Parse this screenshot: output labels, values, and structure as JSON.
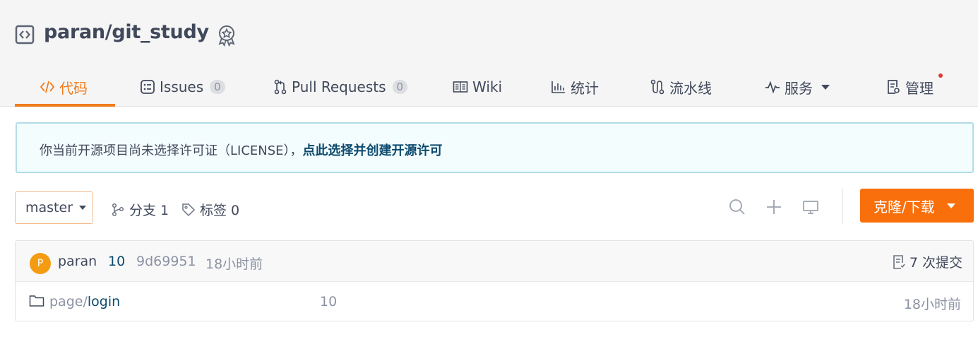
{
  "repo": {
    "title": "paran/git_study"
  },
  "colors": {
    "accent": "#f17c1c",
    "button": "#f96f0b",
    "link": "#0c4a6e",
    "notice_border": "#b3dde6",
    "avatar": "#f39c12"
  },
  "tabs": [
    {
      "label": "代码",
      "icon": "code-icon",
      "active": true
    },
    {
      "label": "Issues",
      "icon": "issues-icon",
      "count": "0"
    },
    {
      "label": "Pull Requests",
      "icon": "pull-request-icon",
      "count": "0"
    },
    {
      "label": "Wiki",
      "icon": "book-icon"
    },
    {
      "label": "统计",
      "icon": "chart-icon"
    },
    {
      "label": "流水线",
      "icon": "pipeline-icon"
    },
    {
      "label": "服务",
      "icon": "pulse-icon"
    },
    {
      "label": "管理",
      "icon": "settings-doc-icon"
    }
  ],
  "notice": {
    "text": "你当前开源项目尚未选择许可证（LICENSE），",
    "link": "点此选择并创建开源许可"
  },
  "toolbar": {
    "branch": "master",
    "branches": "分支 1",
    "tags": "标签 0",
    "clone_label": "克隆/下载"
  },
  "commit": {
    "avatar_letter": "P",
    "author": "paran",
    "message": "10",
    "hash": "9d69951",
    "time": "18小时前",
    "count": "7 次提交"
  },
  "files": [
    {
      "prefix": "page/",
      "name": "login",
      "message": "10",
      "time": "18小时前"
    }
  ]
}
